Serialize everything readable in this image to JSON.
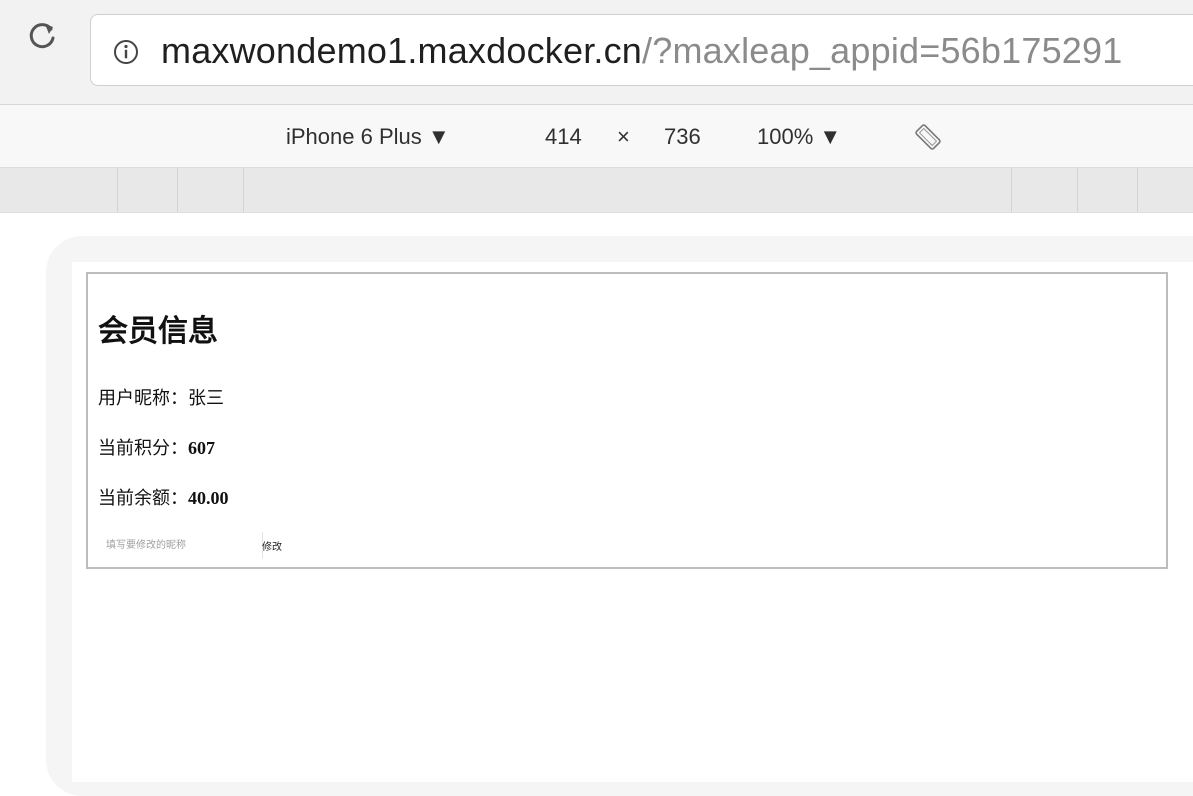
{
  "browser": {
    "url_host": "maxwondemo1.maxdocker.cn",
    "url_path": "/?maxleap_appid=56b175291"
  },
  "device_toolbar": {
    "device": "iPhone 6 Plus ▼",
    "width": "414",
    "times": "×",
    "height": "736",
    "zoom": "100% ▼"
  },
  "member": {
    "title": "会员信息",
    "nickname_label": "用户昵称：",
    "nickname_value": "张三",
    "points_label": "当前积分：",
    "points_value": "607",
    "balance_label": "当前余额：",
    "balance_value": "40.00",
    "input_placeholder": "填写要修改的昵称",
    "modify_button": "修改"
  },
  "icons": {
    "reload": "reload-icon",
    "info": "info-icon",
    "rotate": "rotate-icon"
  }
}
